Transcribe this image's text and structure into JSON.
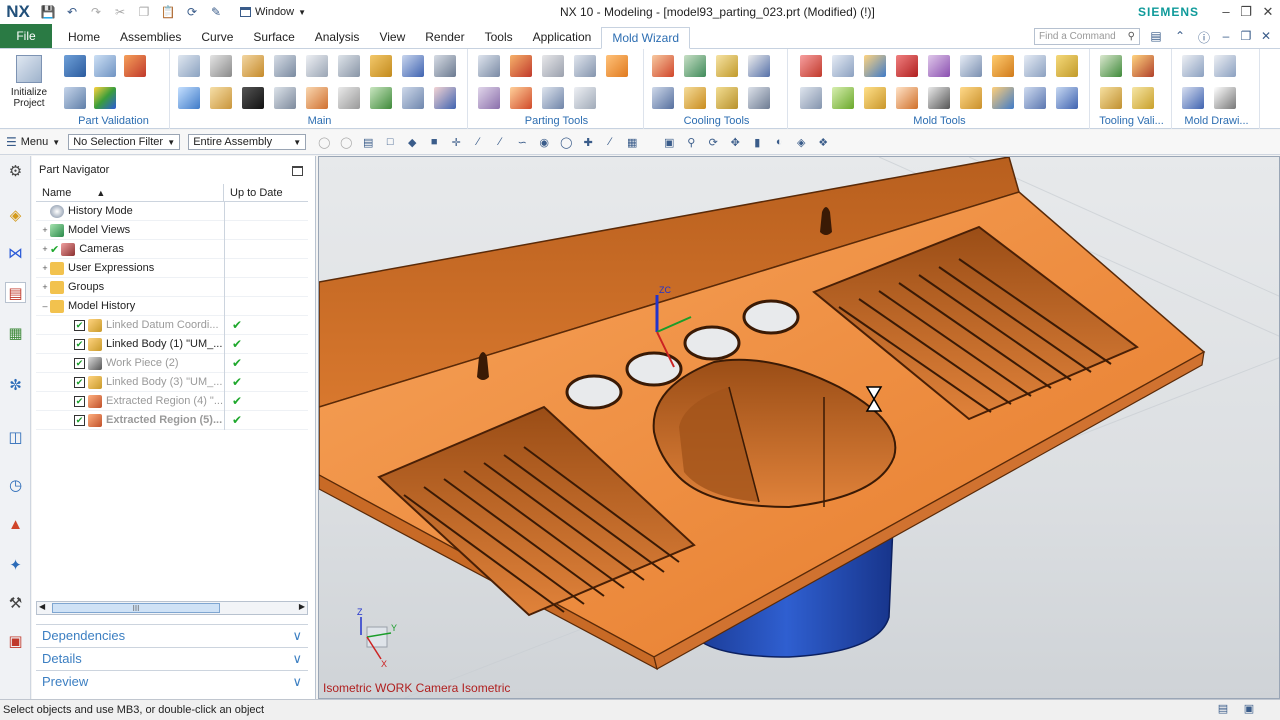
{
  "app": {
    "logo": "NX",
    "title": "NX 10 - Modeling - [model93_parting_023.prt (Modified)   (!)]",
    "brand": "SIEMENS",
    "window_menu": "Window"
  },
  "tabs": [
    "File",
    "Home",
    "Assemblies",
    "Curve",
    "Surface",
    "Analysis",
    "View",
    "Render",
    "Tools",
    "Application",
    "Mold Wizard"
  ],
  "active_tab": "Mold Wizard",
  "search": {
    "placeholder": "Find a Command"
  },
  "ribbon": {
    "init_project": "Initialize Project",
    "groups": [
      "Part Validation",
      "Main",
      "Parting Tools",
      "Cooling Tools",
      "Mold Tools",
      "Tooling Vali...",
      "Mold Drawi..."
    ]
  },
  "selection_bar": {
    "menu": "Menu",
    "filter": "No Selection Filter",
    "scope": "Entire Assembly"
  },
  "navigator": {
    "title": "Part Navigator",
    "col_name": "Name",
    "col_uptodate": "Up to Date",
    "rows": [
      {
        "label": "History Mode"
      },
      {
        "label": "Model Views"
      },
      {
        "label": "Cameras"
      },
      {
        "label": "User Expressions"
      },
      {
        "label": "Groups"
      },
      {
        "label": "Model History"
      },
      {
        "label": "Linked Datum Coordi..."
      },
      {
        "label": "Linked Body (1) \"UM_..."
      },
      {
        "label": "Work Piece (2)"
      },
      {
        "label": "Linked Body (3) \"UM_..."
      },
      {
        "label": "Extracted Region (4) \"..."
      },
      {
        "label": "Extracted Region (5)..."
      }
    ],
    "scroll_thumb": "III",
    "panels": [
      "Dependencies",
      "Details",
      "Preview"
    ]
  },
  "viewport": {
    "label": "Isometric WORK Camera Isometric",
    "axis_zc": "ZC",
    "axis_z": "Z",
    "axis_y": "Y",
    "axis_x": "X"
  },
  "status": {
    "message": "Select objects and use MB3, or double-click an object"
  },
  "colors": {
    "file_tab": "#2a7a44",
    "accent": "#2d6eb2",
    "sink": "#f08a3c",
    "bowl": "#1f47a8"
  }
}
